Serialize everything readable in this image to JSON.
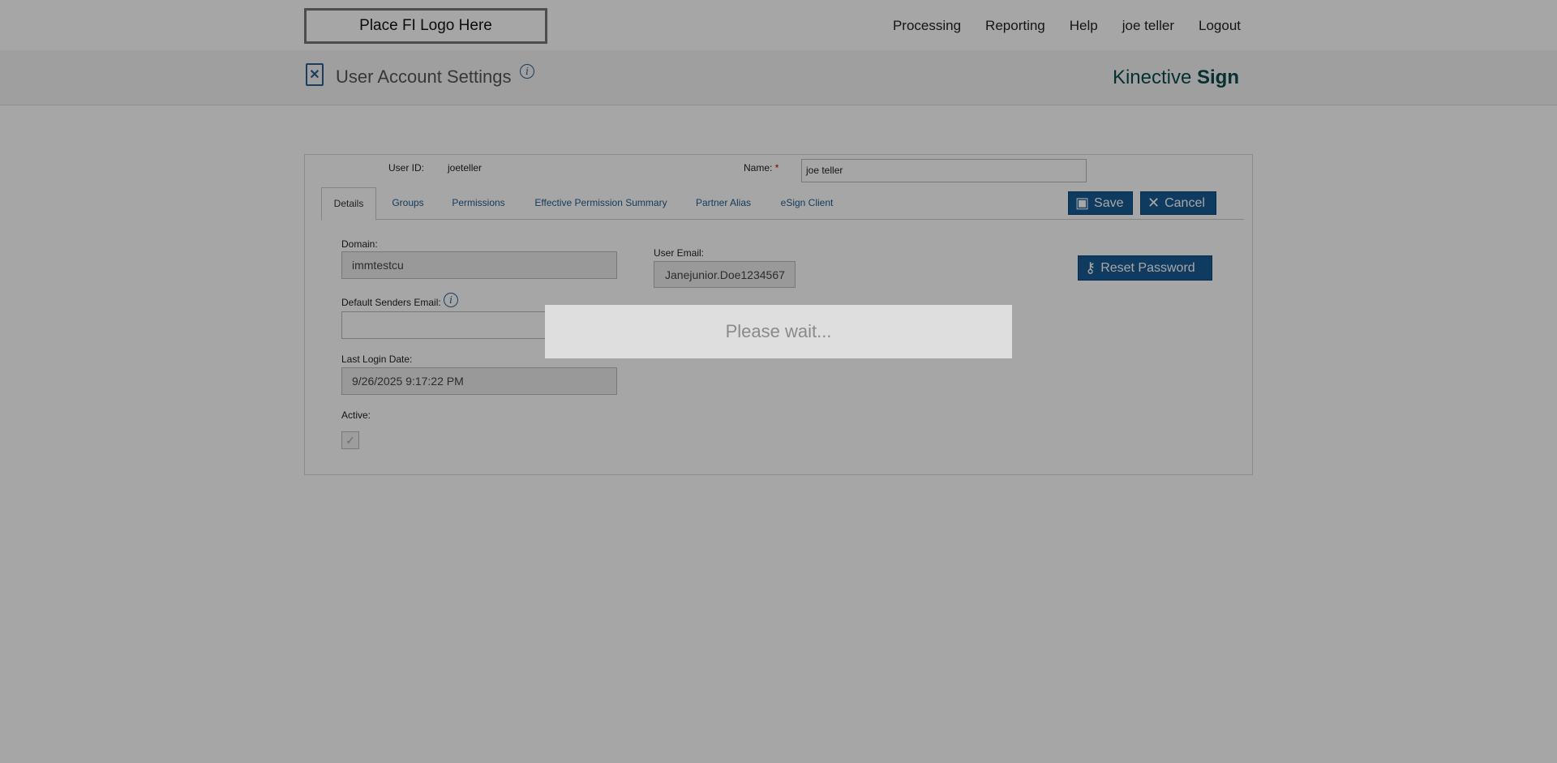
{
  "header": {
    "logo_text": "Place FI Logo Here",
    "nav": [
      "Processing",
      "Reporting",
      "Help",
      "joe teller",
      "Logout"
    ]
  },
  "subheader": {
    "title": "User Account Settings",
    "info_icon": "i",
    "brand_light": "Kinective",
    "brand_bold": "Sign"
  },
  "user": {
    "id_label": "User ID:",
    "id_value": "joeteller",
    "name_label": "Name:",
    "name_required": "*",
    "name_value": "joe teller"
  },
  "tabs": [
    "Details",
    "Groups",
    "Permissions",
    "Effective Permission Summary",
    "Partner Alias",
    "eSign Client"
  ],
  "buttons": {
    "save": "Save",
    "cancel": "Cancel",
    "reset_password": "Reset Password"
  },
  "details": {
    "domain_label": "Domain:",
    "domain_value": "immtestcu",
    "user_email_label": "User Email:",
    "user_email_value": "Janejunior.Doe1234567",
    "default_senders_label": "Default Senders Email:",
    "default_senders_value": "",
    "last_login_label": "Last Login Date:",
    "last_login_value": "9/26/2025 9:17:22 PM",
    "active_label": "Active:",
    "active_checked": true
  },
  "loading": {
    "message": "Please wait..."
  },
  "colors": {
    "accent": "#1a5b96",
    "brand": "#0d4a4a",
    "overlay": "rgba(0,0,0,0.35)"
  }
}
